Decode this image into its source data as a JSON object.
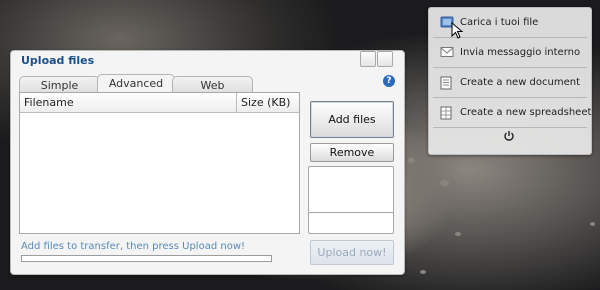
{
  "dialog": {
    "title": "Upload files",
    "tabs": [
      {
        "label": "Simple",
        "active": false
      },
      {
        "label": "Advanced",
        "active": true
      },
      {
        "label": "Web",
        "active": false
      }
    ],
    "help_icon": "question-icon",
    "columns": {
      "filename": "Filename",
      "size": "Size (KB)"
    },
    "buttons": {
      "add": "Add files",
      "remove": "Remove",
      "upload": "Upload now!"
    },
    "hint": "Add files to transfer, then press Upload now!",
    "progress": 0
  },
  "menu": {
    "items": [
      {
        "label": "Carica i tuoi file",
        "icon": "upload-icon"
      },
      {
        "label": "Invia messaggio interno",
        "icon": "envelope-icon"
      },
      {
        "label": "Create a new document",
        "icon": "document-icon"
      },
      {
        "label": "Create a new spreadsheet",
        "icon": "spreadsheet-icon"
      }
    ],
    "power_icon": "power-icon"
  },
  "colors": {
    "title": "#1a4f8a",
    "hint": "#5b8ab6",
    "upload_disabled_text": "#9aa9bd"
  }
}
